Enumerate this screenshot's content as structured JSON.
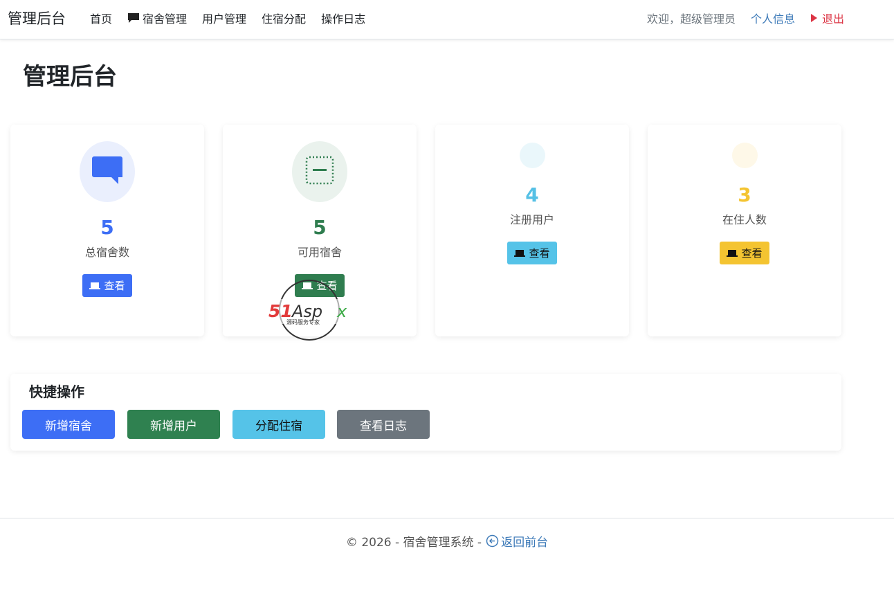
{
  "navbar": {
    "brand": "管理后台",
    "links": [
      {
        "label": "首页",
        "icon": ""
      },
      {
        "label": "宿舍管理",
        "icon": "chat-bubble-icon"
      },
      {
        "label": "用户管理",
        "icon": ""
      },
      {
        "label": "住宿分配",
        "icon": ""
      },
      {
        "label": "操作日志",
        "icon": ""
      }
    ],
    "welcome": "欢迎，超级管理员",
    "profile": "个人信息",
    "logout": "退出"
  },
  "page_title": "管理后台",
  "stats": [
    {
      "value": "5",
      "label": "总宿舍数",
      "button": "查看",
      "color": "#3d6ef5",
      "icon": "chat-bubble-icon"
    },
    {
      "value": "5",
      "label": "可用宿舍",
      "button": "查看",
      "color": "#2f7d4f",
      "icon": "dotted-square-icon"
    },
    {
      "value": "4",
      "label": "注册用户",
      "button": "查看",
      "color": "#55c0e5",
      "icon": "empty-circle-icon"
    },
    {
      "value": "3",
      "label": "在住人数",
      "button": "查看",
      "color": "#f4c431",
      "icon": "empty-circle-icon"
    }
  ],
  "quick_actions": {
    "title": "快捷操作",
    "buttons": [
      {
        "label": "新增宿舍",
        "color": "#3d6ef5"
      },
      {
        "label": "新增用户",
        "color": "#2f8150"
      },
      {
        "label": "分配住宿",
        "color": "#55c3e8"
      },
      {
        "label": "查看日志",
        "color": "#6c757d"
      }
    ]
  },
  "footer": {
    "text": "© 2026 - 宿舍管理系统 -",
    "link": "返回前台"
  },
  "watermark": {
    "brand": "51Aspx",
    "tagline": "源码服务专家"
  }
}
